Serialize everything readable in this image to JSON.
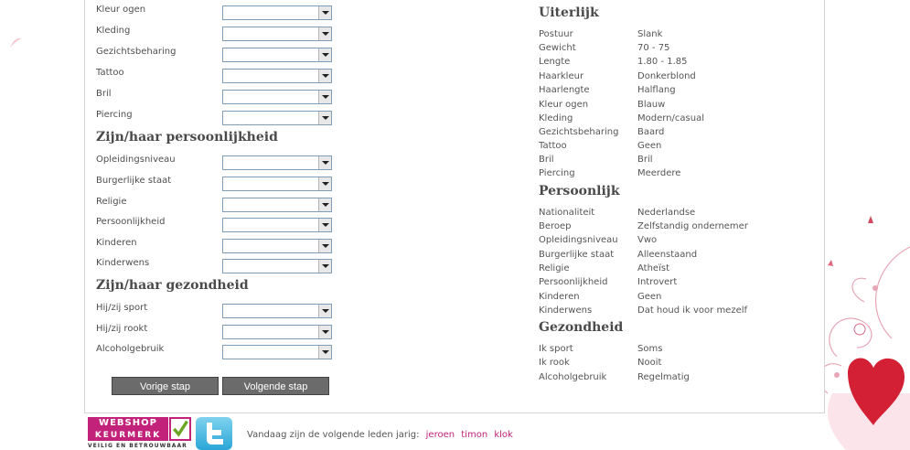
{
  "form": {
    "appearance_rows": [
      {
        "label": "Kleur ogen"
      },
      {
        "label": "Kleding"
      },
      {
        "label": "Gezichtsbeharing"
      },
      {
        "label": "Tattoo"
      },
      {
        "label": "Bril"
      },
      {
        "label": "Piercing"
      }
    ],
    "personality_title": "Zijn/haar persoonlijkheid",
    "personality_rows": [
      {
        "label": "Opleidingsniveau"
      },
      {
        "label": "Burgerlijke staat"
      },
      {
        "label": "Religie"
      },
      {
        "label": "Persoonlijkheid"
      },
      {
        "label": "Kinderen"
      },
      {
        "label": "Kinderwens"
      }
    ],
    "health_title": "Zijn/haar gezondheid",
    "health_rows": [
      {
        "label": "Hij/zij sport"
      },
      {
        "label": "Hij/zij rookt"
      },
      {
        "label": "Alcoholgebruik"
      }
    ],
    "prev_button": "Vorige stap",
    "next_button": "Volgende stap"
  },
  "profile": {
    "uiterlijk_title": "Uiterlijk",
    "uiterlijk": [
      {
        "k": "Postuur",
        "v": "Slank"
      },
      {
        "k": "Gewicht",
        "v": "70 - 75"
      },
      {
        "k": "Lengte",
        "v": "1.80 - 1.85"
      },
      {
        "k": "Haarkleur",
        "v": "Donkerblond"
      },
      {
        "k": "Haarlengte",
        "v": "Halflang"
      },
      {
        "k": "Kleur ogen",
        "v": "Blauw"
      },
      {
        "k": "Kleding",
        "v": "Modern/casual"
      },
      {
        "k": "Gezichtsbeharing",
        "v": "Baard"
      },
      {
        "k": "Tattoo",
        "v": "Geen"
      },
      {
        "k": "Bril",
        "v": "Bril"
      },
      {
        "k": "Piercing",
        "v": "Meerdere"
      }
    ],
    "persoonlijk_title": "Persoonlijk",
    "persoonlijk": [
      {
        "k": "Nationaliteit",
        "v": "Nederlandse"
      },
      {
        "k": "Beroep",
        "v": "Zelfstandig ondernemer"
      },
      {
        "k": "Opleidingsniveau",
        "v": "Vwo"
      },
      {
        "k": "Burgerlijke staat",
        "v": "Alleenstaand"
      },
      {
        "k": "Religie",
        "v": "Atheïst"
      },
      {
        "k": "Persoonlijkheid",
        "v": "Introvert"
      },
      {
        "k": "Kinderen",
        "v": "Geen"
      },
      {
        "k": "Kinderwens",
        "v": "Dat houd ik voor mezelf"
      }
    ],
    "gezondheid_title": "Gezondheid",
    "gezondheid": [
      {
        "k": "Ik sport",
        "v": "Soms"
      },
      {
        "k": "Ik rook",
        "v": "Nooit"
      },
      {
        "k": "Alcoholgebruik",
        "v": "Regelmatig"
      }
    ]
  },
  "footer": {
    "badge_top": "WEBSHOP",
    "badge_mid": "KEURMERK",
    "badge_bot": "VEILIG EN BETROUWBAAR",
    "birthday_text": "Vandaag zijn de volgende leden jarig:",
    "members": [
      "jeroen",
      "timon",
      "klok"
    ]
  },
  "colors": {
    "accent": "#c2227a",
    "button": "#6b6b6b"
  },
  "icons": {
    "twitter": "twitter-icon",
    "check": "check-icon",
    "dropdown": "chevron-down-icon"
  }
}
